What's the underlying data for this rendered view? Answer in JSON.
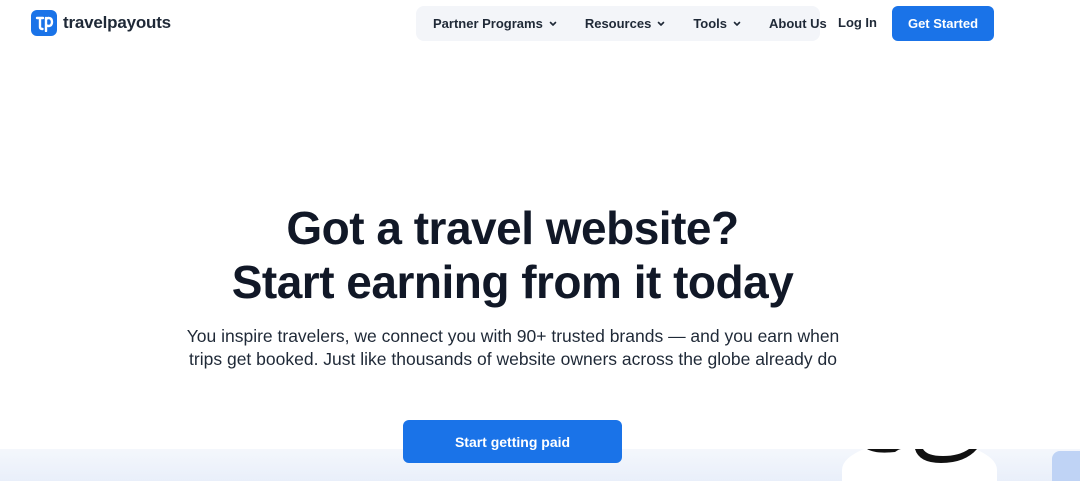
{
  "brand": {
    "name": "travelpayouts",
    "logo_glyph": "tp",
    "accent_color": "#1a73e8"
  },
  "nav": {
    "items": [
      {
        "label": "Partner Programs",
        "has_dropdown": true
      },
      {
        "label": "Resources",
        "has_dropdown": true
      },
      {
        "label": "Tools",
        "has_dropdown": true
      },
      {
        "label": "About Us",
        "has_dropdown": false
      }
    ],
    "login_label": "Log In",
    "cta_label": "Get Started"
  },
  "hero": {
    "title_line1": "Got a travel website?",
    "title_line2": "Start earning from it today",
    "subtitle": "You inspire travelers, we connect you with 90+ trusted brands — and you earn when trips get booked. Just like thousands of website owners across the globe already do",
    "cta_label": "Start getting paid"
  }
}
